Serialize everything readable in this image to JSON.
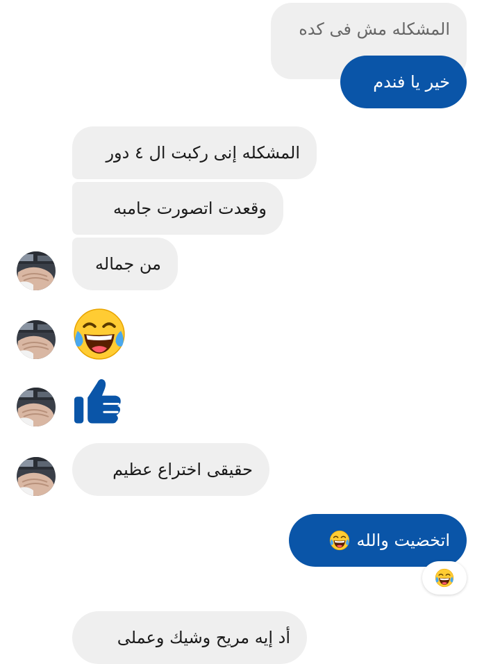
{
  "messages": {
    "m1": "المشكله مش فى كده",
    "m2": "خير يا فندم",
    "m3": "المشكله إنى ركبت ال ٤ دور",
    "m4": "وقعدت اتصورت جامبه",
    "m5": "من جماله",
    "m6": "حقيقى اختراع عظيم",
    "m7": "اتخضيت والله",
    "m8": "أد إيه مريح وشيك وعملى"
  },
  "icons": {
    "avatar": "contact-avatar",
    "laughing": "face-with-tears-of-joy-icon",
    "thumbs_up": "thumbs-up-icon",
    "reaction": "laughing-reaction-icon"
  },
  "colors": {
    "incoming_bubble": "#efefef",
    "outgoing_bubble": "#0a55a8",
    "thumb": "#0a55a8"
  }
}
